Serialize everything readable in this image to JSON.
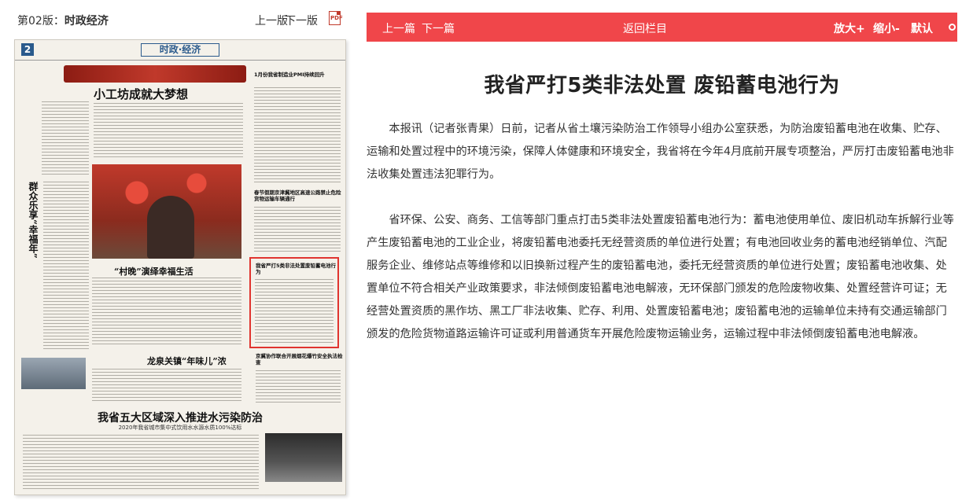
{
  "edition": {
    "label_prefix": "第02版：",
    "label_name": "时政经济",
    "prev": "上一版",
    "next": "下一版",
    "pdf_icon": "pdf-icon"
  },
  "paper": {
    "page_number": "2",
    "section": "时政·经济",
    "headlines": {
      "a": "小工坊成就大梦想",
      "vertical": "群众乐享“幸福年”",
      "b": "“村晚”演绎幸福生活",
      "c": "龙泉关镇“年味儿”浓",
      "r1": "1月份我省制造业PMI持续回升",
      "r2": "春节假期京津冀地区高速公路禁止危险货物运输车辆通行",
      "highlight": "我省严打5类非法处置废铅蓄电池行为",
      "r3": "京冀协作联合开展烟花爆竹安全执法检查",
      "d": "我省五大区域深入推进水污染防治",
      "d_sub": "2020年我省城市集中式饮用水水源水质100%达标"
    }
  },
  "nav": {
    "prev_article": "上一篇",
    "next_article": "下一篇",
    "back_to_column": "返回栏目",
    "zoom_in": "放大+",
    "zoom_out": "缩小-",
    "default": "默认"
  },
  "article": {
    "title": "我省严打5类非法处置 废铅蓄电池行为",
    "paragraphs": [
      "本报讯（记者张青果）日前，记者从省土壤污染防治工作领导小组办公室获悉，为防治废铅蓄电池在收集、贮存、运输和处置过程中的环境污染，保障人体健康和环境安全，我省将在今年4月底前开展专项整治，严厉打击废铅蓄电池非法收集处置违法犯罪行为。",
      "省环保、公安、商务、工信等部门重点打击5类非法处置废铅蓄电池行为：蓄电池使用单位、废旧机动车拆解行业等产生废铅蓄电池的工业企业，将废铅蓄电池委托无经营资质的单位进行处置；有电池回收业务的蓄电池经销单位、汽配服务企业、维修站点等维修和以旧换新过程产生的废铅蓄电池，委托无经营资质的单位进行处置；废铅蓄电池收集、处置单位不符合相关产业政策要求，非法倾倒废铅蓄电池电解液，无环保部门颁发的危险废物收集、处置经营许可证；无经营处置资质的黑作坊、黑工厂非法收集、贮存、利用、处置废铅蓄电池；废铅蓄电池的运输单位未持有交通运输部门颁发的危险货物道路运输许可证或利用普通货车开展危险废物运输业务，运输过程中非法倾倒废铅蓄电池电解液。"
    ]
  }
}
